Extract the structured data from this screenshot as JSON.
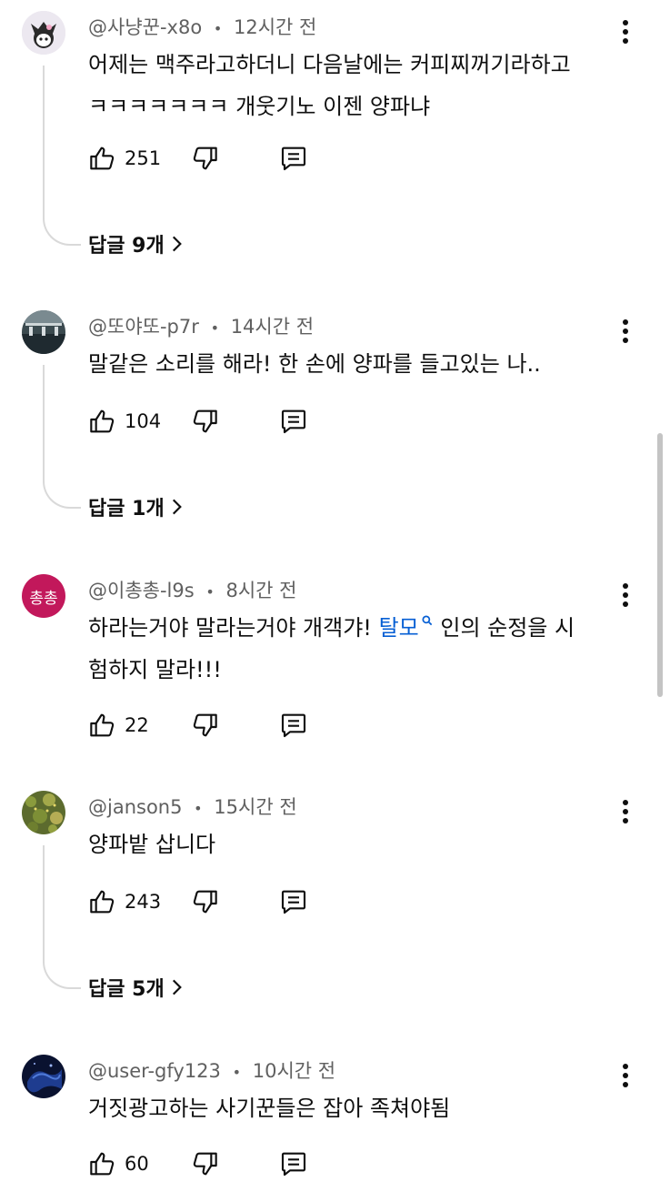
{
  "comments": [
    {
      "author": "@사냥꾼-x8o",
      "time": "12시간 전",
      "text_line1": "어제는 맥주라고하더니 다음날에는 커피찌꺼기라하고",
      "text_line2": "ㅋㅋㅋㅋㅋㅋㅋ 개웃기노 이젠 양파냐",
      "likes": "251",
      "replies": "답글 9개"
    },
    {
      "author": "@또야또-p7r",
      "time": "14시간 전",
      "text_line1": "말같은 소리를 해라! 한 손에 양파를 들고있는 나..",
      "likes": "104",
      "replies": "답글 1개"
    },
    {
      "author": "@이총총-l9s",
      "time": "8시간 전",
      "avatar_text": "총총",
      "text_line1_before": "하라는거야 말라는거야 개객갸! ",
      "text_line1_link": "탈모",
      "text_line1_after": " 인의 순정을 시",
      "text_line2": "험하지 말라!!!",
      "likes": "22"
    },
    {
      "author": "@janson5",
      "time": "15시간 전",
      "text_line1": "양파밭 삽니다",
      "likes": "243",
      "replies": "답글 5개"
    },
    {
      "author": "@user-gfy123",
      "time": "10시간 전",
      "text_line1": "거짓광고하는 사기꾼들은 잡아 족쳐야됨",
      "likes": "60"
    }
  ],
  "separator": "•",
  "icons": {
    "like": "thumbs-up-icon",
    "dislike": "thumbs-down-icon",
    "reply": "comment-icon",
    "more": "more-vertical-icon",
    "chevron": "chevron-right-icon",
    "search": "search-icon"
  },
  "colors": {
    "link": "#065fd4",
    "avatar_3_bg": "#c2185b",
    "meta": "#606060"
  }
}
